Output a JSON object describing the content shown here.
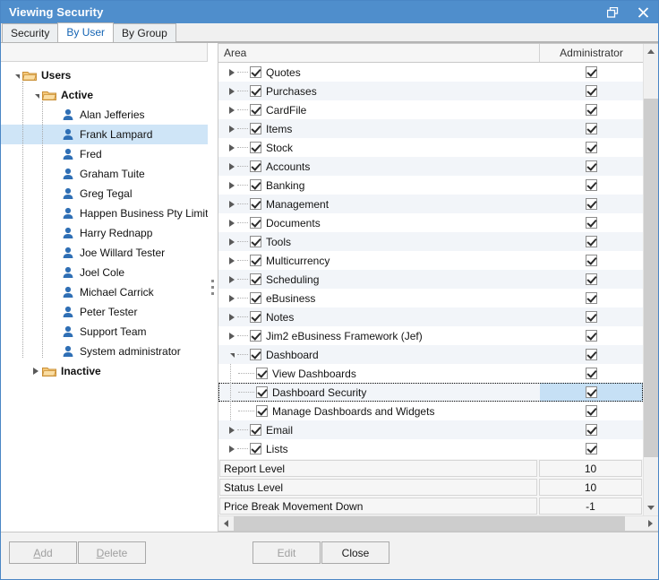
{
  "window": {
    "title": "Viewing Security",
    "restore_icon": "restore-icon",
    "close_icon": "close-icon"
  },
  "tabs": [
    {
      "label": "Security",
      "active": false
    },
    {
      "label": "By User",
      "active": true
    },
    {
      "label": "By Group",
      "active": false
    }
  ],
  "tree": {
    "nodes": [
      {
        "label": "Users",
        "type": "folder",
        "depth": 0,
        "expander": "open",
        "bold": true,
        "selected": false
      },
      {
        "label": "Active",
        "type": "folder",
        "depth": 1,
        "expander": "open",
        "bold": true,
        "selected": false
      },
      {
        "label": "Alan Jefferies",
        "type": "user",
        "depth": 2,
        "expander": "none",
        "bold": false,
        "selected": false
      },
      {
        "label": "Frank Lampard",
        "type": "user",
        "depth": 2,
        "expander": "none",
        "bold": false,
        "selected": true
      },
      {
        "label": "Fred",
        "type": "user",
        "depth": 2,
        "expander": "none",
        "bold": false,
        "selected": false
      },
      {
        "label": "Graham Tuite",
        "type": "user",
        "depth": 2,
        "expander": "none",
        "bold": false,
        "selected": false
      },
      {
        "label": "Greg Tegal",
        "type": "user",
        "depth": 2,
        "expander": "none",
        "bold": false,
        "selected": false
      },
      {
        "label": "Happen Business Pty Limited",
        "type": "user",
        "depth": 2,
        "expander": "none",
        "bold": false,
        "selected": false
      },
      {
        "label": "Harry Rednapp",
        "type": "user",
        "depth": 2,
        "expander": "none",
        "bold": false,
        "selected": false
      },
      {
        "label": "Joe Willard Tester",
        "type": "user",
        "depth": 2,
        "expander": "none",
        "bold": false,
        "selected": false
      },
      {
        "label": "Joel Cole",
        "type": "user",
        "depth": 2,
        "expander": "none",
        "bold": false,
        "selected": false
      },
      {
        "label": "Michael Carrick",
        "type": "user",
        "depth": 2,
        "expander": "none",
        "bold": false,
        "selected": false
      },
      {
        "label": "Peter Tester",
        "type": "user",
        "depth": 2,
        "expander": "none",
        "bold": false,
        "selected": false
      },
      {
        "label": "Support Team",
        "type": "user",
        "depth": 2,
        "expander": "none",
        "bold": false,
        "selected": false
      },
      {
        "label": "System administrator",
        "type": "user",
        "depth": 2,
        "expander": "none",
        "bold": false,
        "selected": false
      },
      {
        "label": "Inactive",
        "type": "folder",
        "depth": 1,
        "expander": "closed",
        "bold": true,
        "selected": false
      }
    ]
  },
  "grid": {
    "columns": {
      "area": "Area",
      "administrator": "Administrator"
    },
    "rows": [
      {
        "label": "Quotes",
        "depth": 0,
        "expander": "closed",
        "checked": true,
        "admin": true,
        "selected": false,
        "focused": false
      },
      {
        "label": "Purchases",
        "depth": 0,
        "expander": "closed",
        "checked": true,
        "admin": true,
        "selected": false,
        "focused": false
      },
      {
        "label": "CardFile",
        "depth": 0,
        "expander": "closed",
        "checked": true,
        "admin": true,
        "selected": false,
        "focused": false
      },
      {
        "label": "Items",
        "depth": 0,
        "expander": "closed",
        "checked": true,
        "admin": true,
        "selected": false,
        "focused": false
      },
      {
        "label": "Stock",
        "depth": 0,
        "expander": "closed",
        "checked": true,
        "admin": true,
        "selected": false,
        "focused": false
      },
      {
        "label": "Accounts",
        "depth": 0,
        "expander": "closed",
        "checked": true,
        "admin": true,
        "selected": false,
        "focused": false
      },
      {
        "label": "Banking",
        "depth": 0,
        "expander": "closed",
        "checked": true,
        "admin": true,
        "selected": false,
        "focused": false
      },
      {
        "label": "Management",
        "depth": 0,
        "expander": "closed",
        "checked": true,
        "admin": true,
        "selected": false,
        "focused": false
      },
      {
        "label": "Documents",
        "depth": 0,
        "expander": "closed",
        "checked": true,
        "admin": true,
        "selected": false,
        "focused": false
      },
      {
        "label": "Tools",
        "depth": 0,
        "expander": "closed",
        "checked": true,
        "admin": true,
        "selected": false,
        "focused": false
      },
      {
        "label": "Multicurrency",
        "depth": 0,
        "expander": "closed",
        "checked": true,
        "admin": true,
        "selected": false,
        "focused": false
      },
      {
        "label": "Scheduling",
        "depth": 0,
        "expander": "closed",
        "checked": true,
        "admin": true,
        "selected": false,
        "focused": false
      },
      {
        "label": "eBusiness",
        "depth": 0,
        "expander": "closed",
        "checked": true,
        "admin": true,
        "selected": false,
        "focused": false
      },
      {
        "label": "Notes",
        "depth": 0,
        "expander": "closed",
        "checked": true,
        "admin": true,
        "selected": false,
        "focused": false
      },
      {
        "label": "Jim2 eBusiness Framework (Jef)",
        "depth": 0,
        "expander": "closed",
        "checked": true,
        "admin": true,
        "selected": false,
        "focused": false
      },
      {
        "label": "Dashboard",
        "depth": 0,
        "expander": "open",
        "checked": true,
        "admin": true,
        "selected": false,
        "focused": false
      },
      {
        "label": "View Dashboards",
        "depth": 1,
        "expander": "none",
        "checked": true,
        "admin": true,
        "selected": false,
        "focused": false
      },
      {
        "label": "Dashboard Security",
        "depth": 1,
        "expander": "none",
        "checked": true,
        "admin": true,
        "selected": true,
        "focused": true
      },
      {
        "label": "Manage Dashboards and Widgets",
        "depth": 1,
        "expander": "none",
        "checked": true,
        "admin": true,
        "selected": false,
        "focused": false
      },
      {
        "label": "Email",
        "depth": 0,
        "expander": "closed",
        "checked": true,
        "admin": true,
        "selected": false,
        "focused": false
      },
      {
        "label": "Lists",
        "depth": 0,
        "expander": "closed",
        "checked": true,
        "admin": true,
        "selected": false,
        "focused": false
      }
    ],
    "footer_rows": [
      {
        "label": "Report Level",
        "value": "10"
      },
      {
        "label": "Status Level",
        "value": "10"
      },
      {
        "label": "Price Break Movement Down",
        "value": "-1"
      }
    ]
  },
  "buttons": [
    {
      "label": "Add",
      "accel": "A",
      "disabled": true
    },
    {
      "label": "Delete",
      "accel": "D",
      "disabled": true
    },
    {
      "label": "Edit",
      "accel": "",
      "disabled": true
    },
    {
      "label": "Close",
      "accel": "",
      "disabled": false
    }
  ],
  "colors": {
    "title_bar": "#4f8ecc",
    "selection": "#cfe5f7",
    "cell_selection": "#c6e0f5",
    "active_tab_text": "#1464b4",
    "row_alt": "#f2f5f9"
  }
}
